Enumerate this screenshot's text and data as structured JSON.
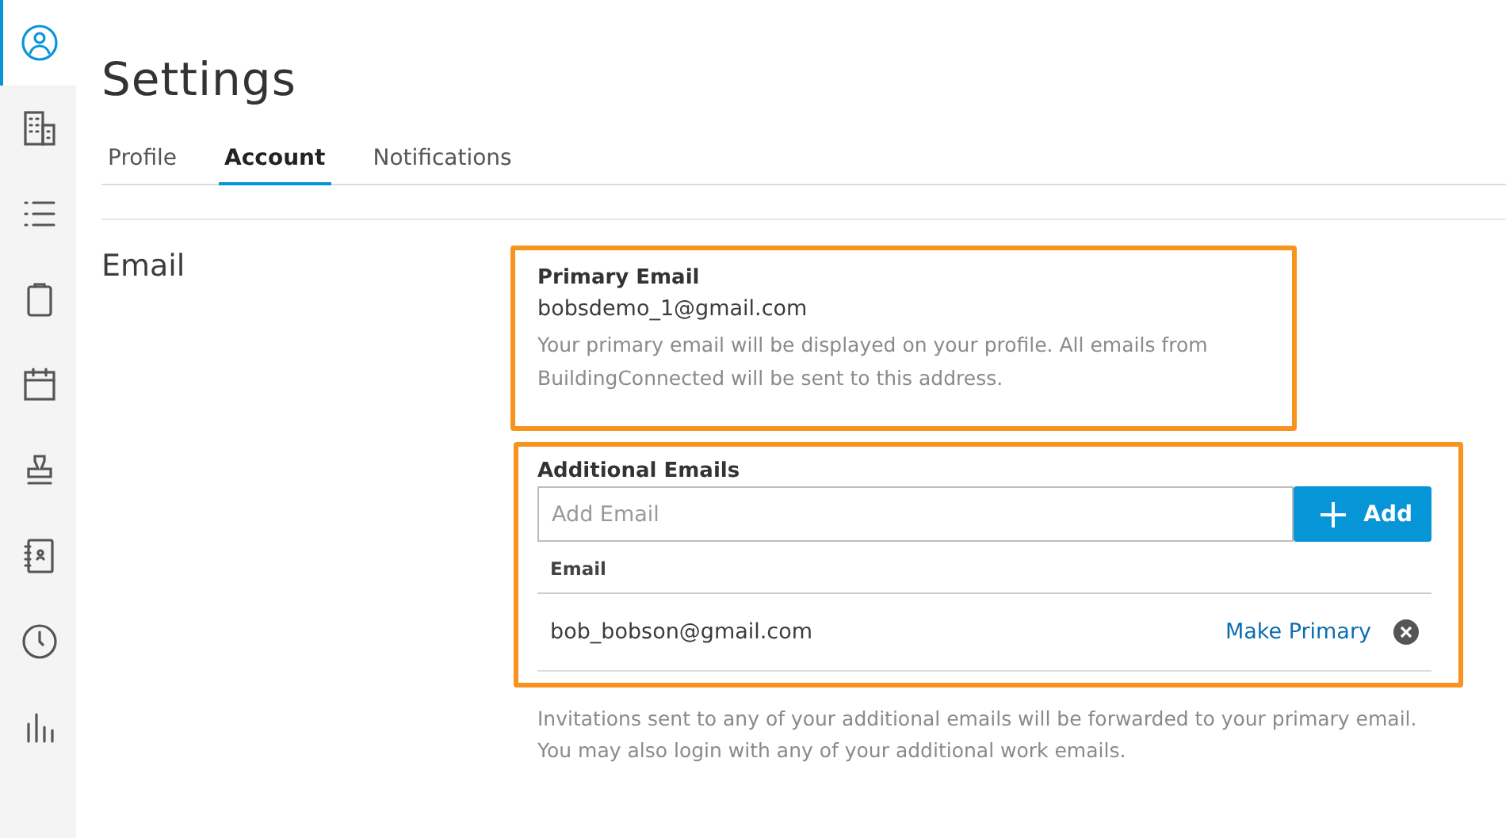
{
  "sidebar": {
    "items": [
      {
        "kind": "person",
        "selected": true
      },
      {
        "kind": "buildings",
        "selected": false
      },
      {
        "kind": "list",
        "selected": false
      },
      {
        "kind": "clipboard",
        "selected": false
      },
      {
        "kind": "calendar",
        "selected": false
      },
      {
        "kind": "stamp",
        "selected": false
      },
      {
        "kind": "contacts",
        "selected": false
      },
      {
        "kind": "clock",
        "selected": false
      },
      {
        "kind": "chart",
        "selected": false
      }
    ]
  },
  "page_title": "Settings",
  "tabs": [
    {
      "label": "Profile",
      "selected": false
    },
    {
      "label": "Account",
      "selected": true
    },
    {
      "label": "Notifications",
      "selected": false
    }
  ],
  "section": {
    "title": "Email",
    "primary": {
      "label": "Primary Email",
      "email": "bobsdemo_1@gmail.com",
      "note": "Your primary email will be displayed on your profile. All emails from BuildingConnected will be sent to this address."
    },
    "additional": {
      "label": "Additional Emails",
      "input": {
        "placeholder": "Add Email"
      },
      "add_button": "Add",
      "table": {
        "columns": [
          "Email"
        ],
        "rows": [
          {
            "email": "bob_bobson@gmail.com",
            "action": "Make Primary"
          }
        ]
      }
    },
    "footnote": "Invitations sent to any of your additional emails will be forwarded to your primary email. You may also login with any of your additional work emails."
  }
}
